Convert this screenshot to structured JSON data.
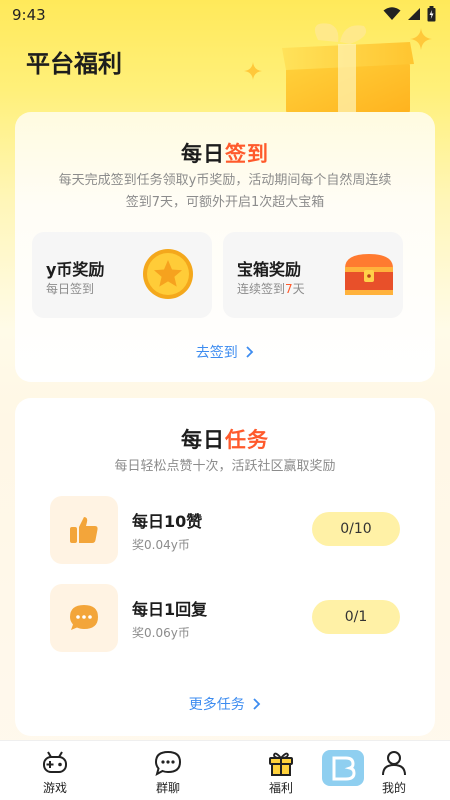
{
  "status_bar": {
    "time": "9:43"
  },
  "page_title": "平台福利",
  "checkin": {
    "title_plain": "每日",
    "title_accent": "签到",
    "desc_line1": "每天完成签到任务领取y币奖励，活动期间每个自然周连续",
    "desc_line2": "签到7天，可额外开启1次超大宝箱",
    "rewards": [
      {
        "title": "y币奖励",
        "subtitle": "每日签到"
      },
      {
        "title": "宝箱奖励",
        "subtitle_prefix": "连续签到",
        "subtitle_num": "7",
        "subtitle_suffix": "天"
      }
    ],
    "link": "去签到"
  },
  "tasks": {
    "title_plain": "每日",
    "title_accent": "任务",
    "desc": "每日轻松点赞十次，活跃社区赢取奖励",
    "items": [
      {
        "name": "每日10赞",
        "reward": "奖0.04y币",
        "progress": "0/10",
        "icon": "thumbs-up-icon"
      },
      {
        "name": "每日1回复",
        "reward": "奖0.06y币",
        "progress": "0/1",
        "icon": "chat-bubble-icon"
      }
    ],
    "link": "更多任务"
  },
  "tab_bar": {
    "tabs": [
      {
        "label": "游戏",
        "icon": "gamepad-icon"
      },
      {
        "label": "群聊",
        "icon": "chat-icon"
      },
      {
        "label": "福利",
        "icon": "gift-icon"
      },
      {
        "label": "我的",
        "icon": "person-icon"
      }
    ]
  },
  "colors": {
    "accent": "#ff5a2c",
    "link": "#3d8cf0",
    "progress_pill": "#fff1a6",
    "header_yellow": "#ffe95a"
  }
}
